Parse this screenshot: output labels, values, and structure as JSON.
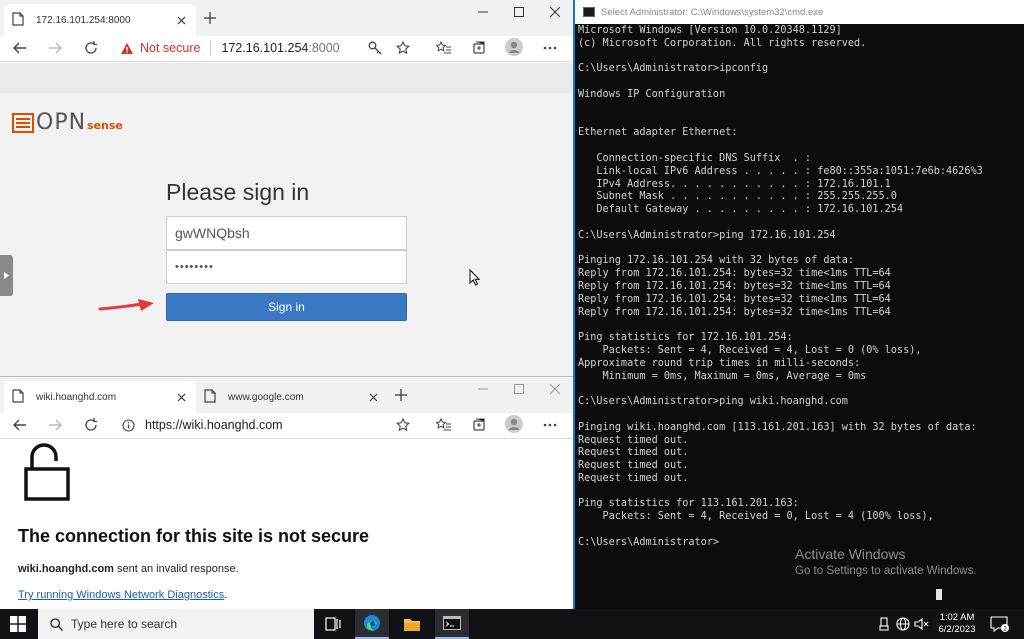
{
  "colors": {
    "edge_blue": "#1e73c8",
    "signin_blue": "#3a78c3",
    "opnsense_orange": "#d94f00",
    "cmd_bg": "#0c0c0c",
    "warning_red": "#d93025",
    "link_blue": "#1a5fb4"
  },
  "opn_browser": {
    "tab_title": "172.16.101.254:8000",
    "security_label": "Not secure",
    "url_host": "172.16.101.254",
    "url_port": ":8000",
    "page": {
      "logo_text": "OPN",
      "logo_suffix": "sense",
      "signin_title": "Please sign in",
      "username_value": "gwWNQbsh",
      "password_value": "••••••••",
      "signin_button": "Sign in"
    }
  },
  "wiki_browser": {
    "tabs": [
      {
        "title": "wiki.hoanghd.com"
      },
      {
        "title": "www.google.com"
      }
    ],
    "url": "https://wiki.hoanghd.com",
    "error": {
      "title": "The connection for this site is not secure",
      "host": "wiki.hoanghd.com",
      "message": " sent an invalid response.",
      "link": "Try running Windows Network Diagnostics",
      "link_suffix": "."
    }
  },
  "cmd": {
    "title": "Select Administrator: C:\\Windows\\system32\\cmd.exe",
    "output": "Microsoft Windows [Version 10.0.20348.1129]\n(c) Microsoft Corporation. All rights reserved.\n\nC:\\Users\\Administrator>ipconfig\n\nWindows IP Configuration\n\n\nEthernet adapter Ethernet:\n\n   Connection-specific DNS Suffix  . :\n   Link-local IPv6 Address . . . . . : fe80::355a:1051:7e6b:4626%3\n   IPv4 Address. . . . . . . . . . . : 172.16.101.1\n   Subnet Mask . . . . . . . . . . . : 255.255.255.0\n   Default Gateway . . . . . . . . . : 172.16.101.254\n\nC:\\Users\\Administrator>ping 172.16.101.254\n\nPinging 172.16.101.254 with 32 bytes of data:\nReply from 172.16.101.254: bytes=32 time<1ms TTL=64\nReply from 172.16.101.254: bytes=32 time<1ms TTL=64\nReply from 172.16.101.254: bytes=32 time<1ms TTL=64\nReply from 172.16.101.254: bytes=32 time<1ms TTL=64\n\nPing statistics for 172.16.101.254:\n    Packets: Sent = 4, Received = 4, Lost = 0 (0% loss),\nApproximate round trip times in milli-seconds:\n    Minimum = 0ms, Maximum = 0ms, Average = 0ms\n\nC:\\Users\\Administrator>ping wiki.hoanghd.com\n\nPinging wiki.hoanghd.com [113.161.201.163] with 32 bytes of data:\nRequest timed out.\nRequest timed out.\nRequest timed out.\nRequest timed out.\n\nPing statistics for 113.161.201.163:\n    Packets: Sent = 4, Received = 0, Lost = 4 (100% loss),\n\nC:\\Users\\Administrator>",
    "watermark_line1": "Activate Windows",
    "watermark_line2": "Go to Settings to activate Windows."
  },
  "taskbar": {
    "search_placeholder": "Type here to search",
    "time": "1:02 AM",
    "date": "6/2/2023",
    "apps": [
      "task-view",
      "edge",
      "file-explorer",
      "command-prompt"
    ]
  }
}
